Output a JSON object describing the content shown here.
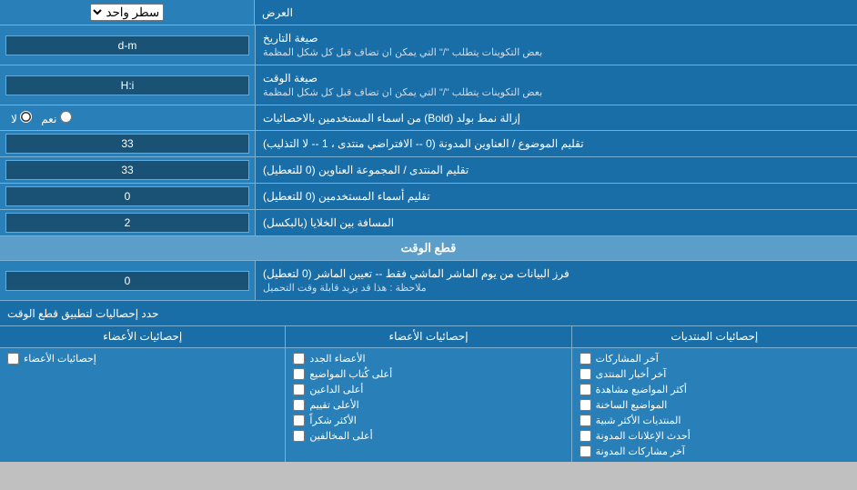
{
  "page": {
    "title": "العرض",
    "top_select_label": "العرض",
    "top_select_options": [
      "سطر واحد"
    ],
    "top_select_value": "سطر واحد",
    "date_format_label": "صيغة التاريخ",
    "date_format_sublabel": "بعض التكوينات يتطلب \"/\" التي يمكن ان تضاف قبل كل شكل المظمة",
    "date_format_value": "d-m",
    "time_format_label": "صيغة الوقت",
    "time_format_sublabel": "بعض التكوينات يتطلب \"/\" التي يمكن ان تضاف قبل كل شكل المظمة",
    "time_format_value": "H:i",
    "bold_label": "إزالة نمط بولد (Bold) من اسماء المستخدمين بالاحصائيات",
    "bold_option1": "نعم",
    "bold_option2": "لا",
    "subjects_label": "تقليم الموضوع / العناوين المدونة (0 -- الافتراضي منتدى ، 1 -- لا التذليب)",
    "subjects_value": "33",
    "forum_label": "تقليم المنتدى / المجموعة العناوين (0 للتعطيل)",
    "forum_value": "33",
    "usernames_label": "تقليم أسماء المستخدمين (0 للتعطيل)",
    "usernames_value": "0",
    "spacing_label": "المسافة بين الخلايا (بالبكسل)",
    "spacing_value": "2",
    "cutoff_header": "قطع الوقت",
    "cutoff_label": "فرز البيانات من يوم الماشر الماشي فقط -- تعيين الماشر (0 لتعطيل)",
    "cutoff_sublabel": "ملاحظة : هذا قد يزيد قابلة وقت التحميل",
    "cutoff_value": "0",
    "limit_label": "حدد إحصاليات لتطبيق قطع الوقت",
    "col1_header": "إحصائيات المنتديات",
    "col2_header": "إحصائيات الأعضاء",
    "col3_header": "",
    "col1_items": [
      "آخر المشاركات",
      "آخر أخبار المنتدى",
      "أكثر المواضيع مشاهدة",
      "المواضيع الساخنة",
      "المنتديات الأكثر شبية",
      "أحدث الإعلانات المدونة",
      "آخر مشاركات المدونة"
    ],
    "col2_items": [
      "الأعضاء الجدد",
      "أعلى كُتاب المواضيع",
      "أعلى الداعين",
      "الأعلى تقييم",
      "الأكثر شكراً",
      "أعلى المخالفين"
    ],
    "col3_items": [
      "إحصائيات الأعضاء"
    ]
  }
}
